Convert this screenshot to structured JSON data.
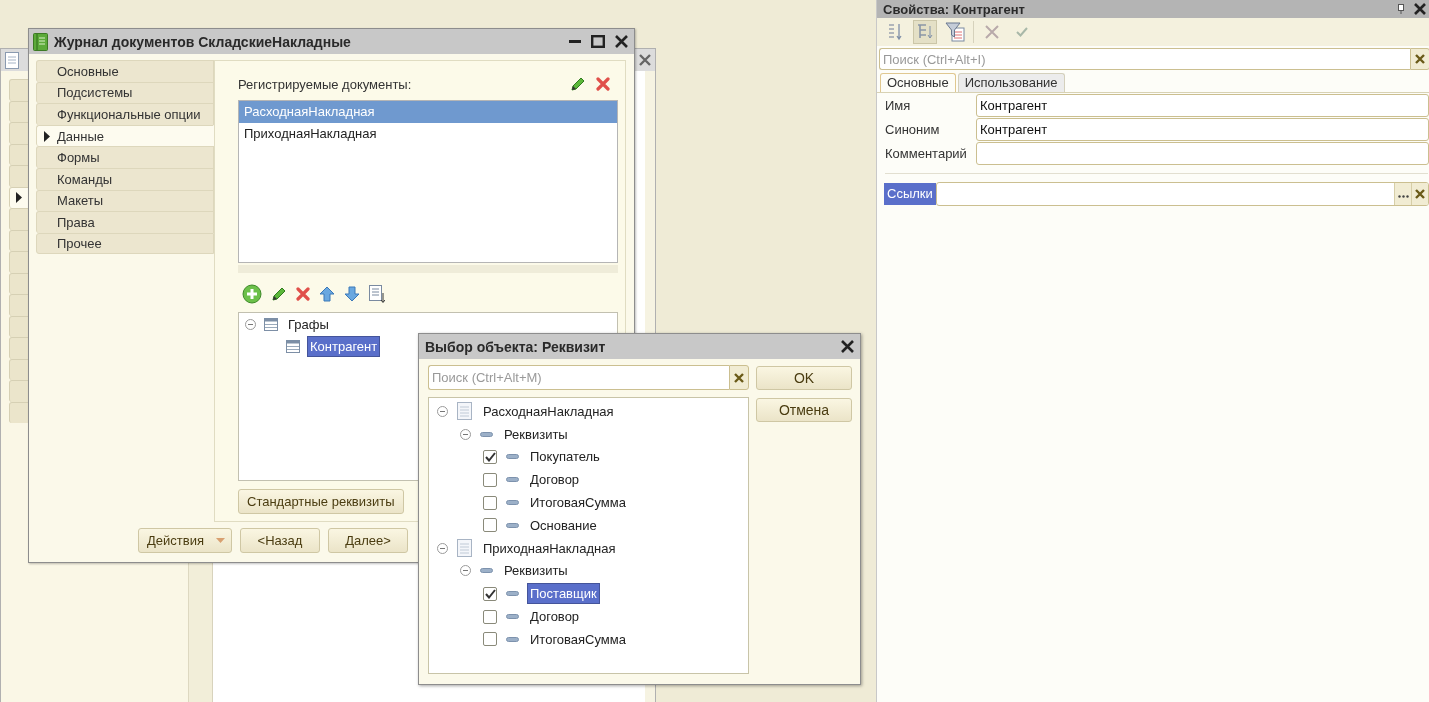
{
  "background_window": {
    "tab_stubs": [
      {
        "selected": false
      },
      {
        "selected": false
      },
      {
        "selected": false
      },
      {
        "selected": false
      },
      {
        "selected": false
      },
      {
        "selected": true
      },
      {
        "selected": false
      },
      {
        "selected": false
      },
      {
        "selected": false
      },
      {
        "selected": false
      },
      {
        "selected": false
      },
      {
        "selected": false
      },
      {
        "selected": false
      },
      {
        "selected": false
      },
      {
        "selected": false
      },
      {
        "selected": false
      }
    ]
  },
  "main_window": {
    "title": "Журнал документов СкладскиеНакладные",
    "tabs": [
      {
        "label": "Основные",
        "selected": false
      },
      {
        "label": "Подсистемы",
        "selected": false
      },
      {
        "label": "Функциональные опции",
        "selected": false
      },
      {
        "label": "Данные",
        "selected": true
      },
      {
        "label": "Формы",
        "selected": false
      },
      {
        "label": "Команды",
        "selected": false
      },
      {
        "label": "Макеты",
        "selected": false
      },
      {
        "label": "Права",
        "selected": false
      },
      {
        "label": "Прочее",
        "selected": false
      }
    ],
    "documents_label": "Регистрируемые документы:",
    "documents": [
      {
        "label": "РасходнаяНакладная",
        "selected": true
      },
      {
        "label": "ПриходнаяНакладная",
        "selected": false
      }
    ],
    "columns_tree": [
      {
        "label": "Графы",
        "expanded": true,
        "selected": false,
        "children": [
          {
            "label": "Контрагент",
            "selected": true
          }
        ]
      }
    ],
    "standard_button": "Стандартные реквизиты",
    "footer_buttons": [
      {
        "label": "Действия",
        "kind": "dropdown"
      },
      {
        "label": "<Назад",
        "kind": "plain"
      },
      {
        "label": "Далее>",
        "kind": "plain"
      }
    ]
  },
  "dialog": {
    "title": "Выбор объекта: Реквизит",
    "search": {
      "placeholder": "Поиск (Ctrl+Alt+M)"
    },
    "buttons": [
      "OK",
      "Отмена"
    ],
    "tree": [
      {
        "kind": "document",
        "label": "РасходнаяНакладная",
        "expanded": true,
        "selected": false,
        "children": [
          {
            "kind": "group",
            "label": "Реквизиты",
            "expanded": true,
            "selected": false,
            "children": [
              {
                "kind": "attribute",
                "label": "Покупатель",
                "checked": true,
                "selected": false
              },
              {
                "kind": "attribute",
                "label": "Договор",
                "checked": false,
                "selected": false
              },
              {
                "kind": "attribute",
                "label": "ИтоговаяСумма",
                "checked": false,
                "selected": false
              },
              {
                "kind": "attribute",
                "label": "Основание",
                "checked": false,
                "selected": false
              }
            ]
          }
        ]
      },
      {
        "kind": "document",
        "label": "ПриходнаяНакладная",
        "expanded": true,
        "selected": false,
        "children": [
          {
            "kind": "group",
            "label": "Реквизиты",
            "expanded": true,
            "selected": false,
            "children": [
              {
                "kind": "attribute",
                "label": "Поставщик",
                "checked": true,
                "selected": true
              },
              {
                "kind": "attribute",
                "label": "Договор",
                "checked": false,
                "selected": false
              },
              {
                "kind": "attribute",
                "label": "ИтоговаяСумма",
                "checked": false,
                "selected": false
              }
            ]
          }
        ]
      }
    ]
  },
  "properties": {
    "title": "Свойства: Контрагент",
    "toolbar": [
      {
        "kind": "sort",
        "on": false
      },
      {
        "kind": "hierarchy",
        "on": true
      },
      {
        "kind": "filter",
        "on": false
      },
      {
        "kind": "delete",
        "on": false
      },
      {
        "kind": "apply",
        "on": false
      }
    ],
    "search": {
      "placeholder": "Поиск (Ctrl+Alt+I)"
    },
    "tabs": [
      {
        "label": "Основные",
        "selected": true
      },
      {
        "label": "Использование",
        "selected": false
      }
    ],
    "fields": [
      {
        "label": "Имя",
        "value": "Контрагент"
      },
      {
        "label": "Синоним",
        "value": "Контрагент"
      },
      {
        "label": "Комментарий"
      }
    ],
    "links": {
      "label": "Ссылки",
      "selected": true
    }
  }
}
